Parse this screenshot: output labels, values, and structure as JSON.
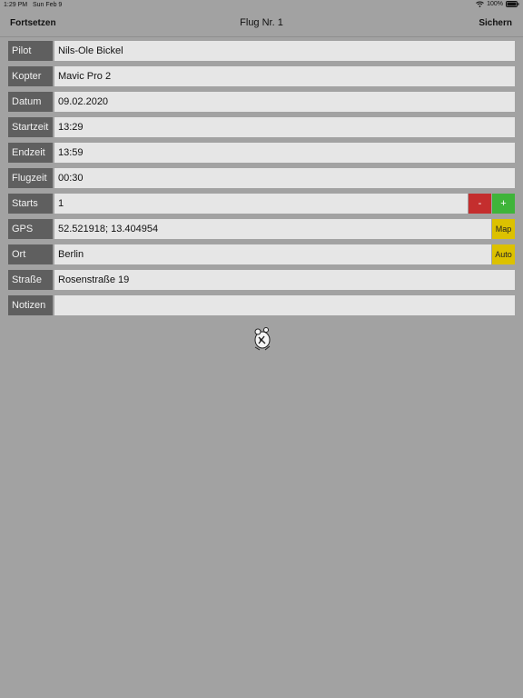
{
  "status": {
    "time": "1:29 PM",
    "date": "Sun Feb 9",
    "battery": "100%"
  },
  "nav": {
    "left": "Fortsetzen",
    "title": "Flug Nr. 1",
    "right": "Sichern"
  },
  "fields": {
    "pilot": {
      "label": "Pilot",
      "value": "Nils-Ole Bickel"
    },
    "kopter": {
      "label": "Kopter",
      "value": "Mavic Pro 2"
    },
    "datum": {
      "label": "Datum",
      "value": "09.02.2020"
    },
    "startzeit": {
      "label": "Startzeit",
      "value": "13:29"
    },
    "endzeit": {
      "label": "Endzeit",
      "value": "13:59"
    },
    "flugzeit": {
      "label": "Flugzeit",
      "value": "00:30"
    },
    "starts": {
      "label": "Starts",
      "value": "1",
      "minus": "-",
      "plus": "+"
    },
    "gps": {
      "label": "GPS",
      "value": "52.521918; 13.404954",
      "button": "Map"
    },
    "ort": {
      "label": "Ort",
      "value": "Berlin",
      "button": "Auto"
    },
    "strasse": {
      "label": "Straße",
      "value": "Rosenstraße 19"
    },
    "notizen": {
      "label": "Notizen",
      "value": ""
    }
  },
  "colors": {
    "background": "#a2a2a2",
    "label_bg": "#5f5f5f",
    "field_bg": "#e6e6e6",
    "minus": "#c42e2e",
    "plus": "#3fb43a",
    "yellow": "#dcc100"
  }
}
